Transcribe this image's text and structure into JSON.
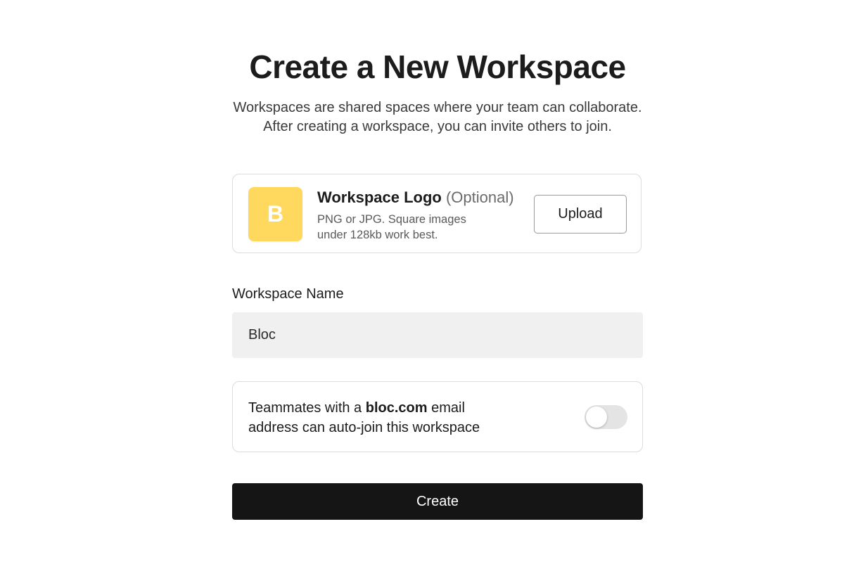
{
  "header": {
    "title": "Create a New Workspace",
    "subtitle_line1": "Workspaces are shared spaces where your team can collaborate.",
    "subtitle_line2": "After creating a workspace, you can invite others to join."
  },
  "logo_card": {
    "avatar_letter": "B",
    "avatar_color": "#ffd95e",
    "title": "Workspace Logo",
    "optional_label": "(Optional)",
    "description": "PNG or JPG. Square images under 128kb work best.",
    "upload_label": "Upload"
  },
  "workspace_name": {
    "label": "Workspace Name",
    "value": "Bloc"
  },
  "auto_join": {
    "text_prefix": "Teammates with a",
    "domain": "bloc.com",
    "text_suffix": "email address can auto-join this workspace",
    "enabled": false
  },
  "actions": {
    "create_label": "Create"
  },
  "colors": {
    "primary_button": "#151515",
    "input_background": "#f0f0f0",
    "border": "#dcdcdc"
  }
}
